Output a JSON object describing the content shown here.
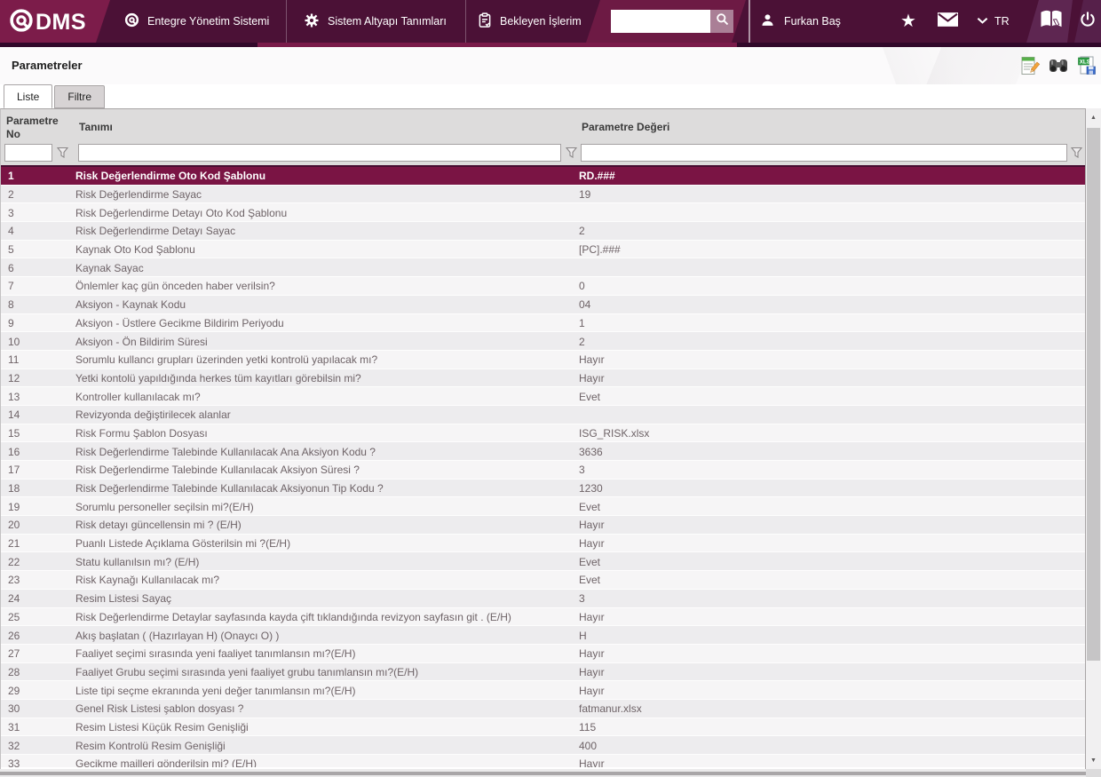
{
  "brand": {
    "name": "DMS"
  },
  "navbar": {
    "menu": [
      {
        "label": "Entegre Yönetim Sistemi"
      },
      {
        "label": "Sistem Altyapı Tanımları"
      },
      {
        "label": "Bekleyen İşlerim"
      }
    ],
    "search_value": "",
    "user_name": "Furkan Baş",
    "language": "TR"
  },
  "page": {
    "title": "Parametreler"
  },
  "tabs": [
    {
      "label": "Liste",
      "active": true
    },
    {
      "label": "Filtre",
      "active": false
    }
  ],
  "toolbar": {
    "icons": [
      "edit-note-icon",
      "find-binoculars-icon",
      "export-excel-icon"
    ]
  },
  "table": {
    "columns": [
      {
        "label": "Parametre No"
      },
      {
        "label": "Tanımı"
      },
      {
        "label": "Parametre Değeri"
      }
    ],
    "filters": [
      "",
      "",
      ""
    ],
    "selected_row_no": 1,
    "rows": [
      {
        "no": 1,
        "name": "Risk Değerlendirme Oto Kod Şablonu",
        "value": "RD.###"
      },
      {
        "no": 2,
        "name": "Risk Değerlendirme Sayac",
        "value": "19"
      },
      {
        "no": 3,
        "name": "Risk Değerlendirme Detayı Oto Kod Şablonu",
        "value": ""
      },
      {
        "no": 4,
        "name": "Risk Değerlendirme Detayı Sayac",
        "value": "2"
      },
      {
        "no": 5,
        "name": "Kaynak Oto Kod Şablonu",
        "value": "[PC].###"
      },
      {
        "no": 6,
        "name": "Kaynak Sayac",
        "value": ""
      },
      {
        "no": 7,
        "name": "Önlemler kaç gün önceden haber verilsin?",
        "value": "0"
      },
      {
        "no": 8,
        "name": "Aksiyon - Kaynak Kodu",
        "value": "04"
      },
      {
        "no": 9,
        "name": "Aksiyon - Üstlere Gecikme Bildirim Periyodu",
        "value": "1"
      },
      {
        "no": 10,
        "name": "Aksiyon - Ön Bildirim Süresi",
        "value": "2"
      },
      {
        "no": 11,
        "name": "Sorumlu kullancı grupları üzerinden yetki kontrolü yapılacak mı?",
        "value": "Hayır"
      },
      {
        "no": 12,
        "name": "Yetki kontolü yapıldığında herkes tüm kayıtları görebilsin mi?",
        "value": "Hayır"
      },
      {
        "no": 13,
        "name": "Kontroller kullanılacak mı?",
        "value": "Evet"
      },
      {
        "no": 14,
        "name": "Revizyonda değiştirilecek alanlar",
        "value": ""
      },
      {
        "no": 15,
        "name": "Risk Formu Şablon Dosyası",
        "value": "ISG_RISK.xlsx"
      },
      {
        "no": 16,
        "name": "Risk Değerlendirme Talebinde Kullanılacak Ana Aksiyon Kodu ?",
        "value": "3636"
      },
      {
        "no": 17,
        "name": "Risk Değerlendirme Talebinde Kullanılacak Aksiyon Süresi ?",
        "value": "3"
      },
      {
        "no": 18,
        "name": "Risk Değerlendirme Talebinde Kullanılacak Aksiyonun Tip Kodu ?",
        "value": "1230"
      },
      {
        "no": 19,
        "name": "Sorumlu personeller seçilsin mi?(E/H)",
        "value": "Evet"
      },
      {
        "no": 20,
        "name": "Risk detayı güncellensin mi ? (E/H)",
        "value": "Hayır"
      },
      {
        "no": 21,
        "name": "Puanlı Listede Açıklama Gösterilsin mi ?(E/H)",
        "value": "Hayır"
      },
      {
        "no": 22,
        "name": "Statu kullanılsın mı? (E/H)",
        "value": "Evet"
      },
      {
        "no": 23,
        "name": "Risk Kaynağı Kullanılacak mı?",
        "value": "Evet"
      },
      {
        "no": 24,
        "name": "Resim Listesi Sayaç",
        "value": "3"
      },
      {
        "no": 25,
        "name": "Risk Değerlendirme Detaylar sayfasında kayda çift tıklandığında revizyon sayfasın git . (E/H)",
        "value": "Hayır"
      },
      {
        "no": 26,
        "name": "Akış başlatan ( (Hazırlayan H) (Onaycı O) )",
        "value": "H"
      },
      {
        "no": 27,
        "name": "Faaliyet seçimi sırasında yeni faaliyet tanımlansın mı?(E/H)",
        "value": "Hayır"
      },
      {
        "no": 28,
        "name": "Faaliyet Grubu seçimi sırasında yeni faaliyet grubu tanımlansın mı?(E/H)",
        "value": "Hayır"
      },
      {
        "no": 29,
        "name": "Liste tipi seçme ekranında yeni değer tanımlansın mı?(E/H)",
        "value": "Hayır"
      },
      {
        "no": 30,
        "name": "Genel Risk Listesi şablon dosyası ?",
        "value": "fatmanur.xlsx"
      },
      {
        "no": 31,
        "name": "Resim Listesi Küçük Resim Genişliği",
        "value": "115"
      },
      {
        "no": 32,
        "name": "Resim Kontrolü Resim Genişliği",
        "value": "400"
      },
      {
        "no": 33,
        "name": "Gecikme mailleri gönderilsin mi? (E/H)",
        "value": "Hayır"
      }
    ]
  },
  "colors": {
    "nav_bg": "#4b1136",
    "brand_accent": "#7b1b4a",
    "selected_row": "#7a1444",
    "grid_header_bg": "#dddcdc",
    "row_text": "#6e6367"
  }
}
